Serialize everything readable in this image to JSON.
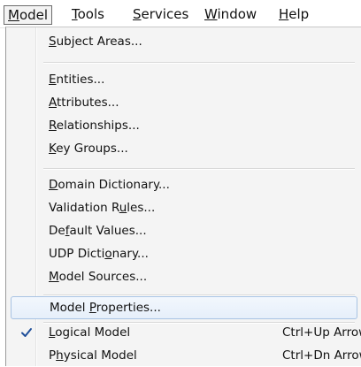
{
  "menubar": {
    "items": [
      {
        "label": "Model",
        "u": "M",
        "rest": "odel"
      },
      {
        "label": "Tools",
        "u": "T",
        "rest": "ools"
      },
      {
        "label": "Services",
        "u": "S",
        "rest": "ervices"
      },
      {
        "label": "Window",
        "u": "W",
        "rest": "indow"
      },
      {
        "label": "Help",
        "u": "H",
        "rest": "elp"
      }
    ]
  },
  "menu": {
    "items": [
      {
        "label": "Subject Areas...",
        "pre": "",
        "u": "S",
        "post": "ubject Areas..."
      },
      {
        "label": "Entities...",
        "pre": "",
        "u": "E",
        "post": "ntities..."
      },
      {
        "label": "Attributes...",
        "pre": "",
        "u": "A",
        "post": "ttributes..."
      },
      {
        "label": "Relationships...",
        "pre": "",
        "u": "R",
        "post": "elationships..."
      },
      {
        "label": "Key Groups...",
        "pre": "",
        "u": "K",
        "post": "ey Groups..."
      },
      {
        "label": "Domain Dictionary...",
        "pre": "",
        "u": "D",
        "post": "omain Dictionary..."
      },
      {
        "label": "Validation Rules...",
        "pre": "Validation R",
        "u": "u",
        "post": "les..."
      },
      {
        "label": "Default Values...",
        "pre": "De",
        "u": "f",
        "post": "ault Values..."
      },
      {
        "label": "UDP Dictionary...",
        "pre": "UDP Dicti",
        "u": "o",
        "post": "nary..."
      },
      {
        "label": "Model Sources...",
        "pre": "",
        "u": "M",
        "post": "odel Sources..."
      },
      {
        "label": "Model Properties...",
        "pre": "Model ",
        "u": "P",
        "post": "roperties..."
      },
      {
        "label": "Logical Model",
        "pre": "",
        "u": "L",
        "post": "ogical Model",
        "shortcut": "Ctrl+Up Arrow",
        "checked": true
      },
      {
        "label": "Physical Model",
        "pre": "P",
        "u": "h",
        "post": "ysical Model",
        "shortcut": "Ctrl+Dn Arrow",
        "checked": false
      }
    ]
  },
  "colors": {
    "highlight_border": "#a8c3e3",
    "checkmark": "#1f4f9a"
  }
}
